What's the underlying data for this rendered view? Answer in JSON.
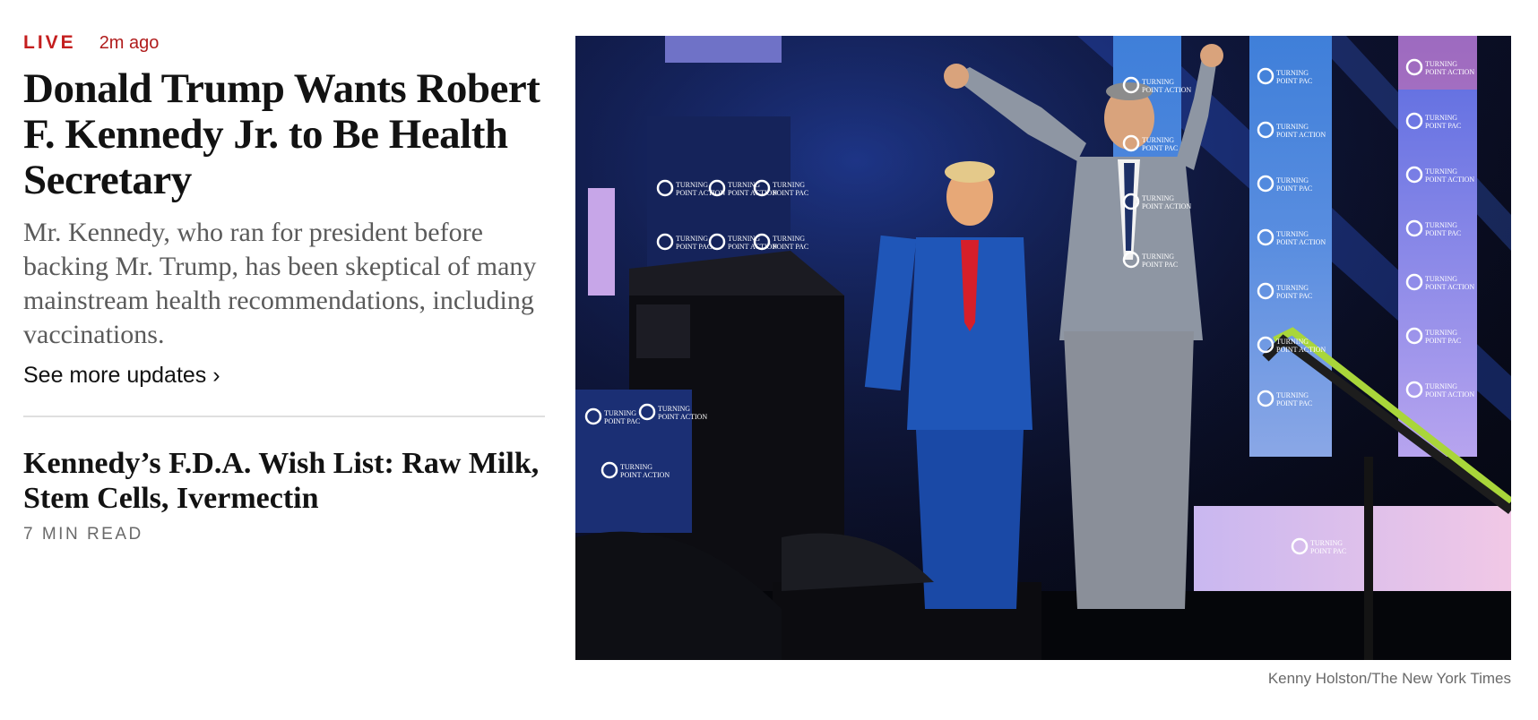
{
  "lead": {
    "live_label": "LIVE",
    "time_ago": "2m ago",
    "headline": "Donald Trump Wants Robert F. Kennedy Jr. to Be Health Secretary",
    "summary": "Mr. Kennedy, who ran for president before backing Mr. Trump, has been skeptical of many mainstream health recommendations, including vaccinations.",
    "see_more": "See more updates ›"
  },
  "secondary": {
    "headline": "Kennedy’s F.D.A. Wish List: Raw Milk, Stem Cells, Ivermectin",
    "read_time": "7 MIN READ"
  },
  "photo": {
    "credit": "Kenny Holston/The New York Times",
    "banner_text": "TURNING POINT ACTION",
    "banner_text_alt": "TURNING POINT PAC"
  },
  "colors": {
    "live_red": "#c41e1e",
    "headline": "#121212",
    "summary": "#5a5a5a"
  }
}
